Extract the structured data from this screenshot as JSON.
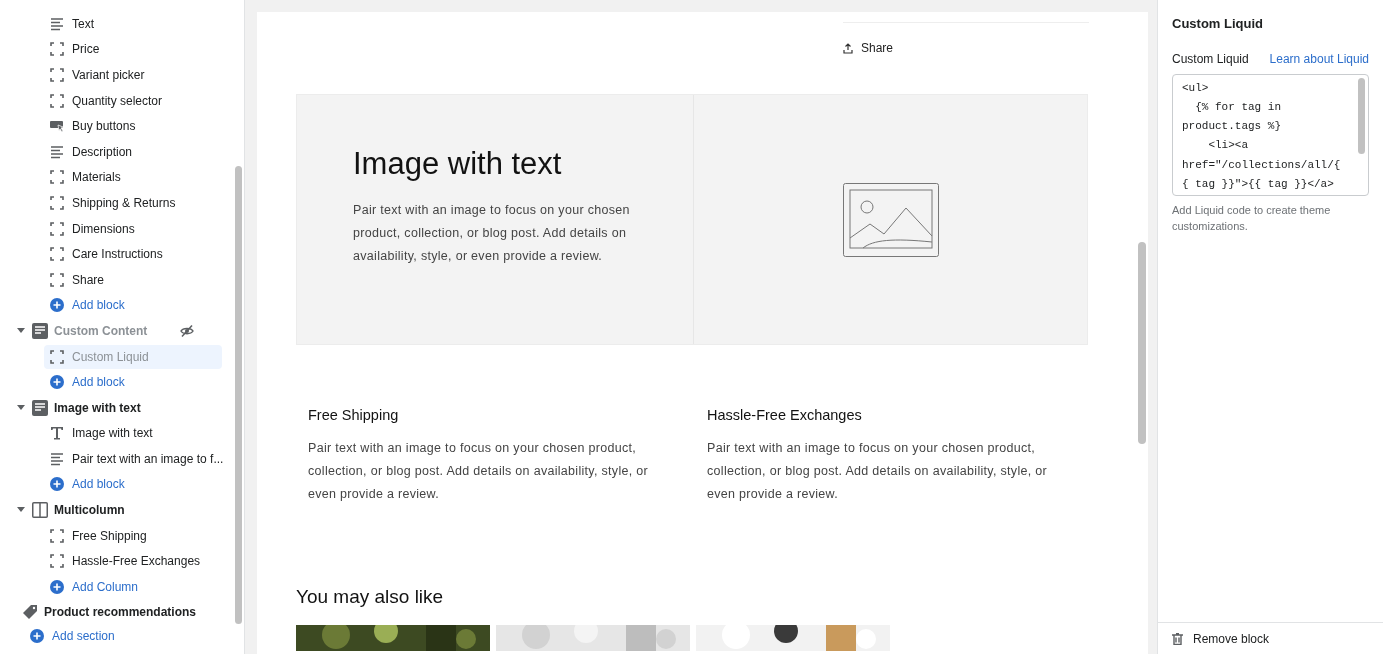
{
  "sidebar": {
    "items": [
      {
        "kind": "text",
        "label": "Text",
        "selected": false
      },
      {
        "kind": "block",
        "label": "Price",
        "selected": false
      },
      {
        "kind": "block",
        "label": "Variant picker",
        "selected": false
      },
      {
        "kind": "block",
        "label": "Quantity selector",
        "selected": false
      },
      {
        "kind": "buy",
        "label": "Buy buttons",
        "selected": false
      },
      {
        "kind": "text",
        "label": "Description",
        "selected": false
      },
      {
        "kind": "block",
        "label": "Materials",
        "selected": false
      },
      {
        "kind": "block",
        "label": "Shipping & Returns",
        "selected": false
      },
      {
        "kind": "block",
        "label": "Dimensions",
        "selected": false
      },
      {
        "kind": "block",
        "label": "Care Instructions",
        "selected": false
      },
      {
        "kind": "block",
        "label": "Share",
        "selected": false
      },
      {
        "kind": "add",
        "label": "Add block",
        "selected": false
      }
    ],
    "sections": [
      {
        "kind": "content",
        "label": "Custom Content",
        "hidden": true,
        "expanded": true,
        "children": [
          {
            "kind": "block",
            "label": "Custom Liquid",
            "selected": true
          },
          {
            "kind": "add",
            "label": "Add block",
            "selected": false
          }
        ]
      },
      {
        "kind": "content",
        "label": "Image with text",
        "hidden": false,
        "expanded": true,
        "children": [
          {
            "kind": "title",
            "label": "Image with text",
            "selected": false
          },
          {
            "kind": "text",
            "label": "Pair text with an image to f...",
            "selected": false
          },
          {
            "kind": "add",
            "label": "Add block",
            "selected": false
          }
        ]
      },
      {
        "kind": "columns",
        "label": "Multicolumn",
        "hidden": false,
        "expanded": true,
        "children": [
          {
            "kind": "block",
            "label": "Free Shipping",
            "selected": false
          },
          {
            "kind": "block",
            "label": "Hassle-Free Exchanges",
            "selected": false
          },
          {
            "kind": "add",
            "label": "Add Column",
            "selected": false
          }
        ]
      },
      {
        "kind": "tag",
        "label": "Product recommendations",
        "hidden": false
      }
    ],
    "add_section": "Add section"
  },
  "preview": {
    "share": "Share",
    "image_with_text": {
      "heading": "Image with text",
      "body": "Pair text with an image to focus on your chosen product, collection, or blog post. Add details on availability, style, or even provide a review."
    },
    "columns": [
      {
        "title": "Free Shipping",
        "body": "Pair text with an image to focus on your chosen product, collection, or blog post. Add details on availability, style, or even provide a review."
      },
      {
        "title": "Hassle-Free Exchanges",
        "body": "Pair text with an image to focus on your chosen product, collection, or blog post. Add details on availability, style, or even provide a review."
      }
    ],
    "recommendations": {
      "heading": "You may also like"
    }
  },
  "settings": {
    "title": "Custom Liquid",
    "field_label": "Custom Liquid",
    "link": "Learn about Liquid",
    "code_lines": [
      "<ul>",
      "  {% for tag in",
      "product.tags %}",
      "    <li><a",
      "href=\"/collections/all/{",
      "{ tag }}\">{{ tag }}</a>"
    ],
    "help": "Add Liquid code to create theme customizations.",
    "remove": "Remove block"
  }
}
